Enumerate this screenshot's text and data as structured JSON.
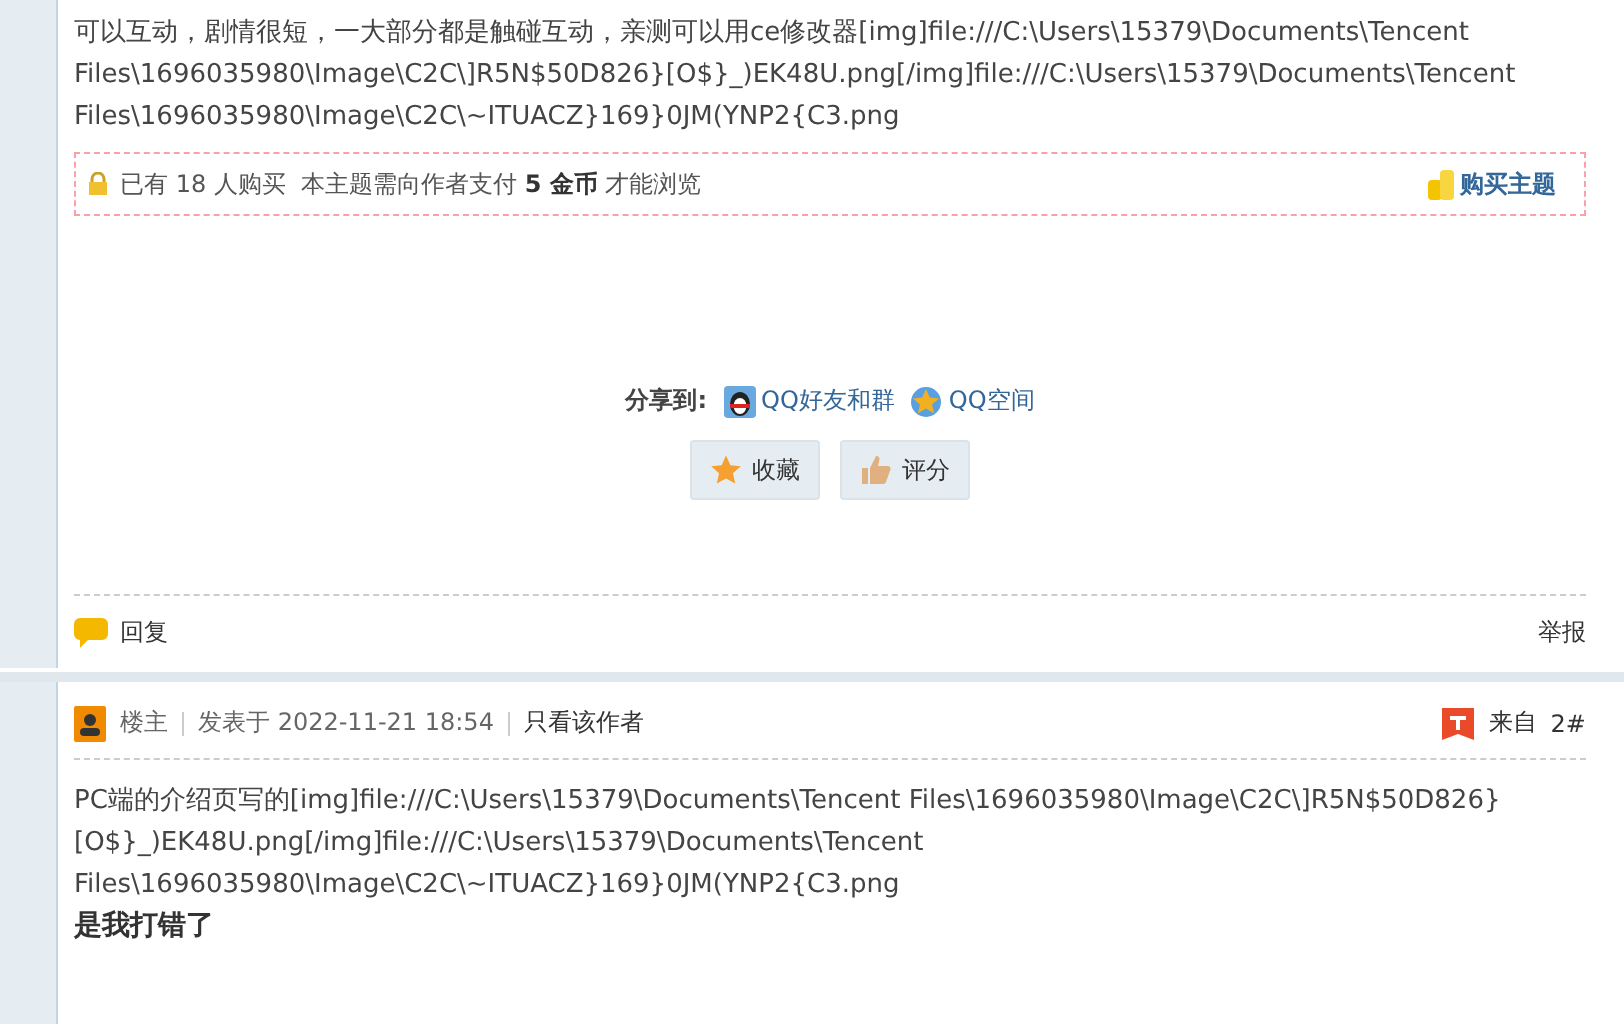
{
  "post1": {
    "body_lines": [
      "可以互动，剧情很短，一大部分都是触碰互动，亲测可以用ce修改器[img]file:///C:\\Users\\15379\\Documents\\Tencent",
      "Files\\1696035980\\Image\\C2C\\]R5N$50D826}[O$}_)EK48U.png[/img]file:///C:\\Users\\15379\\Documents\\Tencent",
      "Files\\1696035980\\Image\\C2C\\~ITUACZ}169}0JM(YNP2{C3.png"
    ],
    "paywall": {
      "text": "已有 18 人购买  本主题需向作者支付 **5 金币** 才能浏览",
      "buy": "购买主题"
    },
    "share": {
      "label": "分享到:",
      "targets": [
        {
          "kind": "qq",
          "label": "QQ好友和群"
        },
        {
          "kind": "qzone",
          "label": "QQ空间"
        }
      ]
    },
    "actions": [
      {
        "kind": "favorite",
        "label": "收藏"
      },
      {
        "kind": "rate",
        "label": "评分"
      }
    ],
    "reply": "回复",
    "report": "举报"
  },
  "post2": {
    "author_label": "楼主",
    "posted": "发表于 2022-11-21 18:54",
    "only_author": "只看该作者",
    "from": "来自",
    "floor": "2#",
    "body_lines": [
      "PC端的介绍页写的[img]file:///C:\\Users\\15379\\Documents\\Tencent Files\\1696035980\\Image\\C2C\\]R5N$50D826}",
      "[O$}_)EK48U.png[/img]file:///C:\\Users\\15379\\Documents\\Tencent",
      "Files\\1696035980\\Image\\C2C\\~ITUACZ}169}0JM(YNP2{C3.png"
    ],
    "bold_line": "是我打错了"
  }
}
